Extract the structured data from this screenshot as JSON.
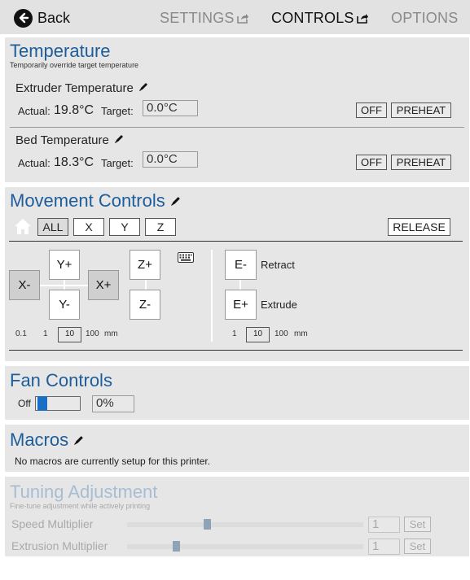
{
  "nav": {
    "back_label": "Back",
    "tabs": [
      {
        "label": "SETTINGS",
        "active": false
      },
      {
        "label": "CONTROLS",
        "active": true
      },
      {
        "label": "OPTIONS",
        "active": false
      }
    ]
  },
  "temperature": {
    "title": "Temperature",
    "subtitle": "Temporarily override target temperature",
    "extruder": {
      "label": "Extruder Temperature",
      "actual_label": "Actual:",
      "actual_value": "19.8°C",
      "target_label": "Target:",
      "target_value": "0.0°C",
      "off_label": "OFF",
      "preheat_label": "PREHEAT"
    },
    "bed": {
      "label": "Bed Temperature",
      "actual_label": "Actual:",
      "actual_value": "18.3°C",
      "target_label": "Target:",
      "target_value": "0.0°C",
      "off_label": "OFF",
      "preheat_label": "PREHEAT"
    }
  },
  "movement": {
    "title": "Movement Controls",
    "home_buttons": [
      "ALL",
      "X",
      "Y",
      "Z"
    ],
    "release_label": "RELEASE",
    "jog": {
      "x_minus": "X-",
      "x_plus": "X+",
      "y_plus": "Y+",
      "y_minus": "Y-",
      "z_plus": "Z+",
      "z_minus": "Z-"
    },
    "xyz_steps": [
      "0.1",
      "1",
      "10",
      "100"
    ],
    "xyz_selected": "10",
    "xyz_unit": "mm",
    "extruder": {
      "retract_button": "E-",
      "retract_label": "Retract",
      "extrude_button": "E+",
      "extrude_label": "Extrude"
    },
    "e_steps": [
      "1",
      "10",
      "100"
    ],
    "e_selected": "10",
    "e_unit": "mm"
  },
  "fan": {
    "title": "Fan Controls",
    "off_label": "Off",
    "value_text": "0%",
    "level": 0
  },
  "macros": {
    "title": "Macros",
    "empty_text": "No macros are currently setup for this printer."
  },
  "tuning": {
    "title": "Tuning Adjustment",
    "subtitle": "Fine-tune adjustment while actively printing",
    "speed": {
      "label": "Speed Multiplier",
      "value": "1",
      "set_label": "Set"
    },
    "extrusion": {
      "label": "Extrusion Multiplier",
      "value": "1",
      "set_label": "Set"
    }
  },
  "colors": {
    "accent": "#1d5d9a",
    "panel_bg": "#e6e6e6",
    "topbar_bg": "#e2e2e2",
    "slider_fill": "#1a6fc4",
    "disabled": "#a9a9a9"
  }
}
